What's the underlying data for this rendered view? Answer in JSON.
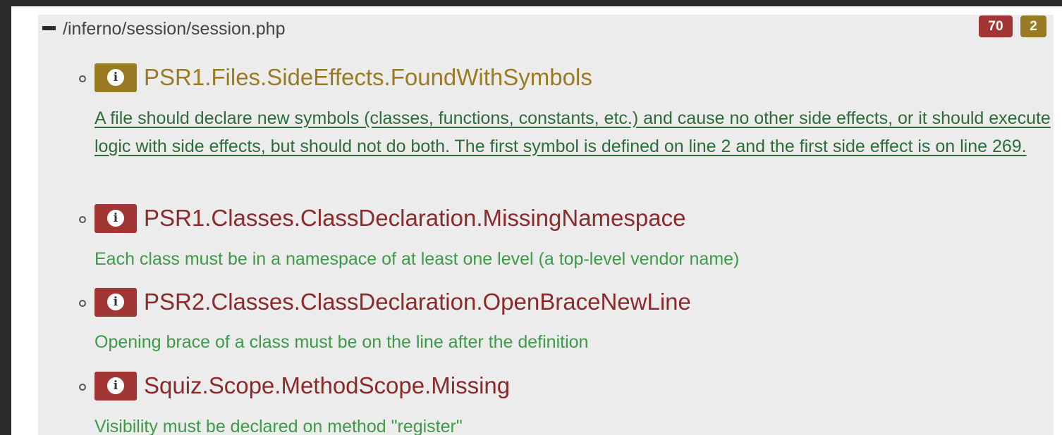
{
  "colors": {
    "error_red": "#a13634",
    "warning_gold": "#9a7b24",
    "message_green": "#3d9a47",
    "link_green": "#2e6b3a"
  },
  "file": {
    "path": "/inferno/session/session.php",
    "collapse_icon": "minus-icon",
    "error_count": "70",
    "warning_count": "2"
  },
  "issues": [
    {
      "severity": "warning",
      "icon": "info-icon",
      "rule": "PSR1.Files.SideEffects.FoundWithSymbols",
      "message": "A file should declare new symbols (classes, functions, constants, etc.) and cause no other side effects, or it should execute logic with side effects, but should not do both. The first symbol is defined on line 2 and the first side effect is on line 269."
    },
    {
      "severity": "error",
      "icon": "info-icon",
      "rule": "PSR1.Classes.ClassDeclaration.MissingNamespace",
      "message": "Each class must be in a namespace of at least one level (a top-level vendor name)"
    },
    {
      "severity": "error",
      "icon": "info-icon",
      "rule": "PSR2.Classes.ClassDeclaration.OpenBraceNewLine",
      "message": "Opening brace of a class must be on the line after the definition"
    },
    {
      "severity": "error",
      "icon": "info-icon",
      "rule": "Squiz.Scope.MethodScope.Missing",
      "message": "Visibility must be declared on method \"register\""
    }
  ]
}
